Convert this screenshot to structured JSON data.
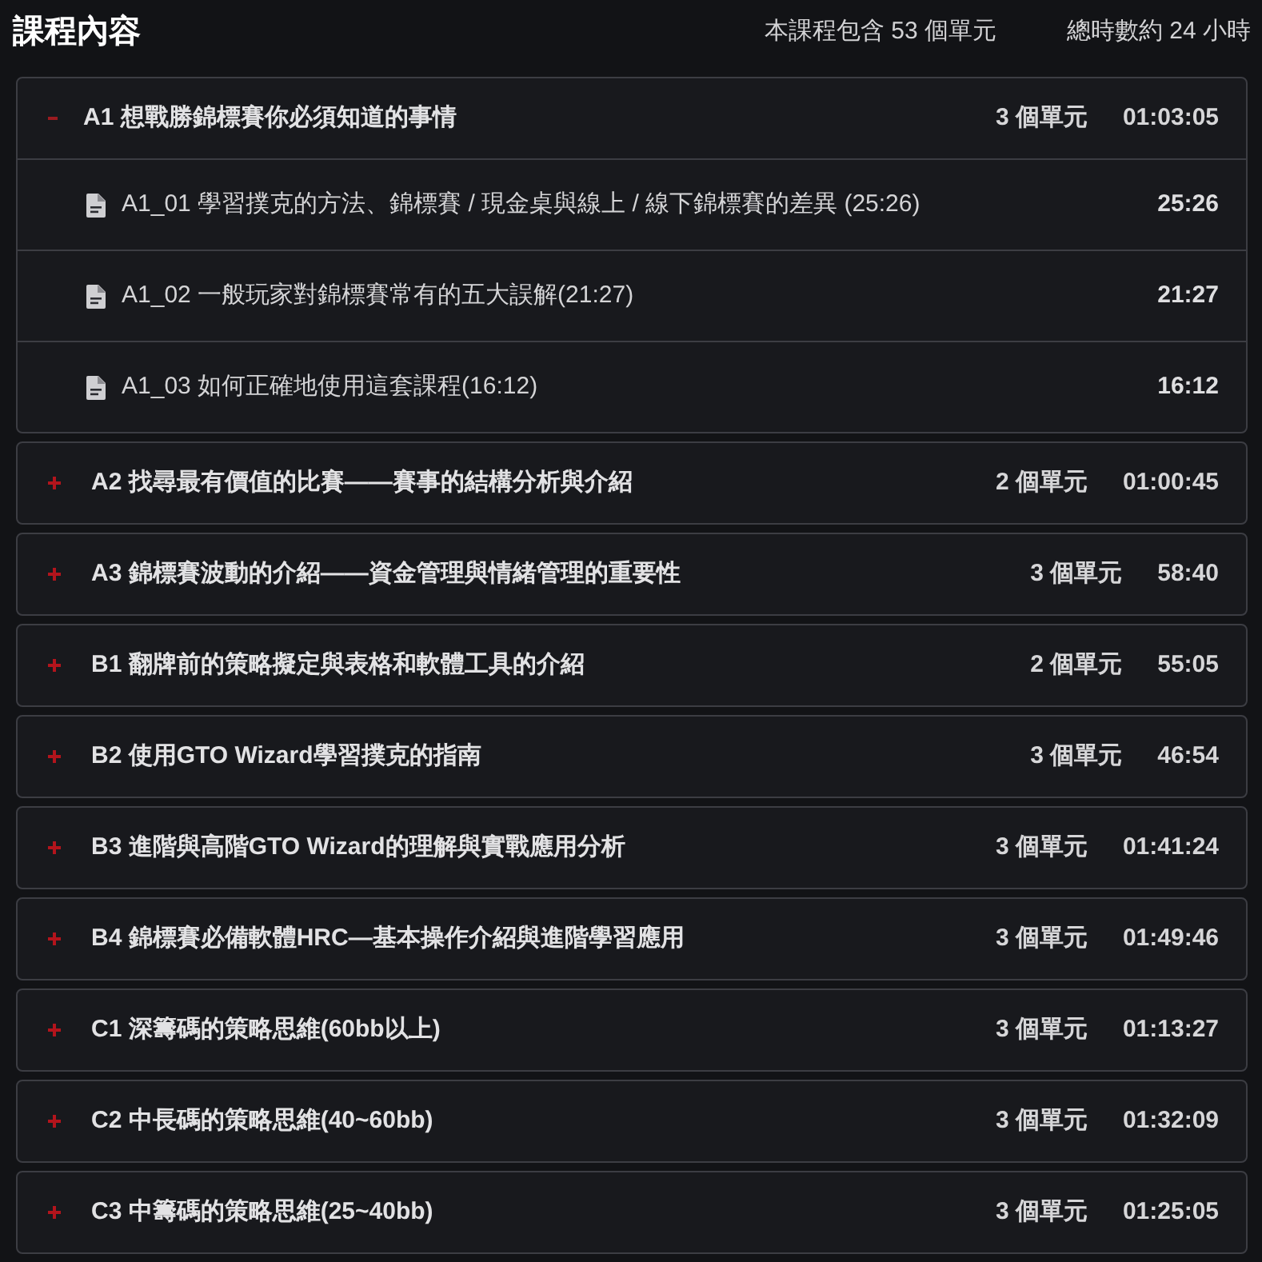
{
  "header": {
    "title": "課程內容",
    "unit_count": "本課程包含 53 個單元",
    "total_hours": "總時數約 24 小時"
  },
  "sections": [
    {
      "title": "A1 想戰勝錦標賽你必須知道的事情",
      "units": "3 個單元",
      "duration": "01:03:05",
      "expanded": true,
      "lectures": [
        {
          "title": "A1_01 學習撲克的方法、錦標賽 / 現金桌與線上 / 線下錦標賽的差異 (25:26)",
          "duration": "25:26"
        },
        {
          "title": "A1_02 一般玩家對錦標賽常有的五大誤解(21:27)",
          "duration": "21:27"
        },
        {
          "title": "A1_03 如何正確地使用這套課程(16:12)",
          "duration": "16:12"
        }
      ]
    },
    {
      "title": "A2 找尋最有價值的比賽——賽事的結構分析與介紹",
      "units": "2 個單元",
      "duration": "01:00:45",
      "expanded": false
    },
    {
      "title": "A3 錦標賽波動的介紹——資金管理與情緒管理的重要性",
      "units": "3 個單元",
      "duration": "58:40",
      "expanded": false
    },
    {
      "title": "B1 翻牌前的策略擬定與表格和軟體工具的介紹",
      "units": "2 個單元",
      "duration": "55:05",
      "expanded": false
    },
    {
      "title": "B2 使用GTO Wizard學習撲克的指南",
      "units": "3 個單元",
      "duration": "46:54",
      "expanded": false
    },
    {
      "title": "B3 進階與高階GTO Wizard的理解與實戰應用分析",
      "units": "3 個單元",
      "duration": "01:41:24",
      "expanded": false
    },
    {
      "title": "B4 錦標賽必備軟體HRC—基本操作介紹與進階學習應用",
      "units": "3 個單元",
      "duration": "01:49:46",
      "expanded": false
    },
    {
      "title": "C1 深籌碼的策略思維(60bb以上)",
      "units": "3 個單元",
      "duration": "01:13:27",
      "expanded": false
    },
    {
      "title": "C2 中長碼的策略思維(40~60bb)",
      "units": "3 個單元",
      "duration": "01:32:09",
      "expanded": false
    },
    {
      "title": "C3 中籌碼的策略思維(25~40bb)",
      "units": "3 個單元",
      "duration": "01:25:05",
      "expanded": false
    }
  ]
}
